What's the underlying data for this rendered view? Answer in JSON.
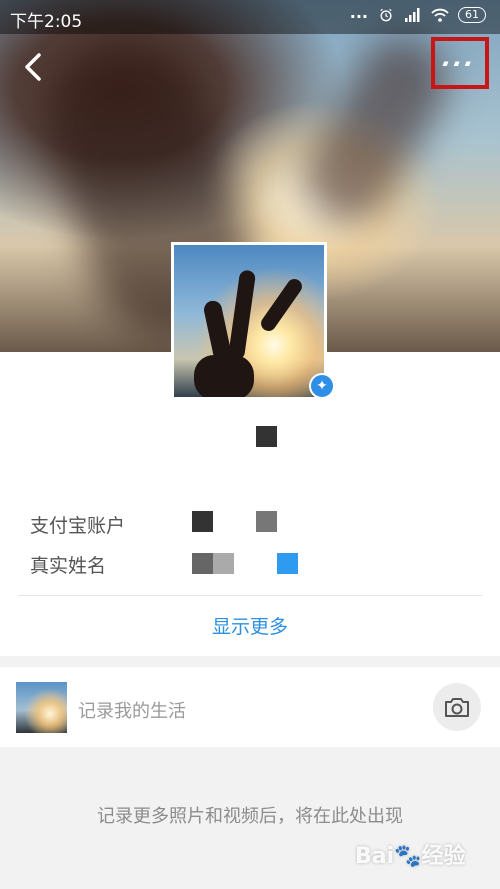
{
  "status_bar": {
    "time": "下午2:05",
    "dots": "...",
    "battery": "61"
  },
  "header": {
    "back_icon": "chevron-left-icon",
    "more_icon": "more-horizontal-icon",
    "more_glyph": "...",
    "highlight_color": "#c81515"
  },
  "profile": {
    "verified_badge_icon": "sparkle-badge-icon",
    "fields": [
      {
        "label": "支付宝账户"
      },
      {
        "label": "真实姓名"
      }
    ],
    "show_more_label": "显示更多",
    "accent_color": "#2d8fe0"
  },
  "life": {
    "title": "记录我的生活",
    "camera_icon": "camera-icon",
    "empty_note": "记录更多照片和视频后，将在此处出现"
  },
  "watermark": {
    "text": "Bai 经验"
  }
}
